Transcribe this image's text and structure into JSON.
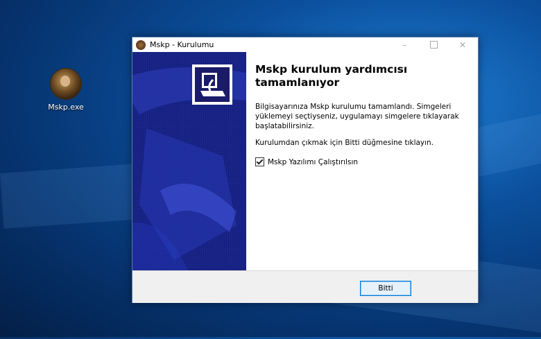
{
  "desktop": {
    "icon": {
      "label": "Mskp.exe",
      "icon": "game-exe-icon"
    }
  },
  "window": {
    "title": "Mskp - Kurulumu",
    "controls": {
      "minimize": "–",
      "close": "✕"
    },
    "heading": "Mskp kurulum yardımcısı tamamlanıyor",
    "paragraph1": "Bilgisayarınıza Mskp kurulumu tamamlandı. Simgeleri yüklemeyi seçtiyseniz, uygulamayı simgelere tıklayarak başlatabilirsiniz.",
    "paragraph2": "Kurulumdan çıkmak için Bitti düğmesine tıklayın.",
    "checkbox": {
      "label": "Mskp Yazılımı Çalıştırılsın",
      "checked": true
    },
    "finish_button": "Bitti"
  }
}
